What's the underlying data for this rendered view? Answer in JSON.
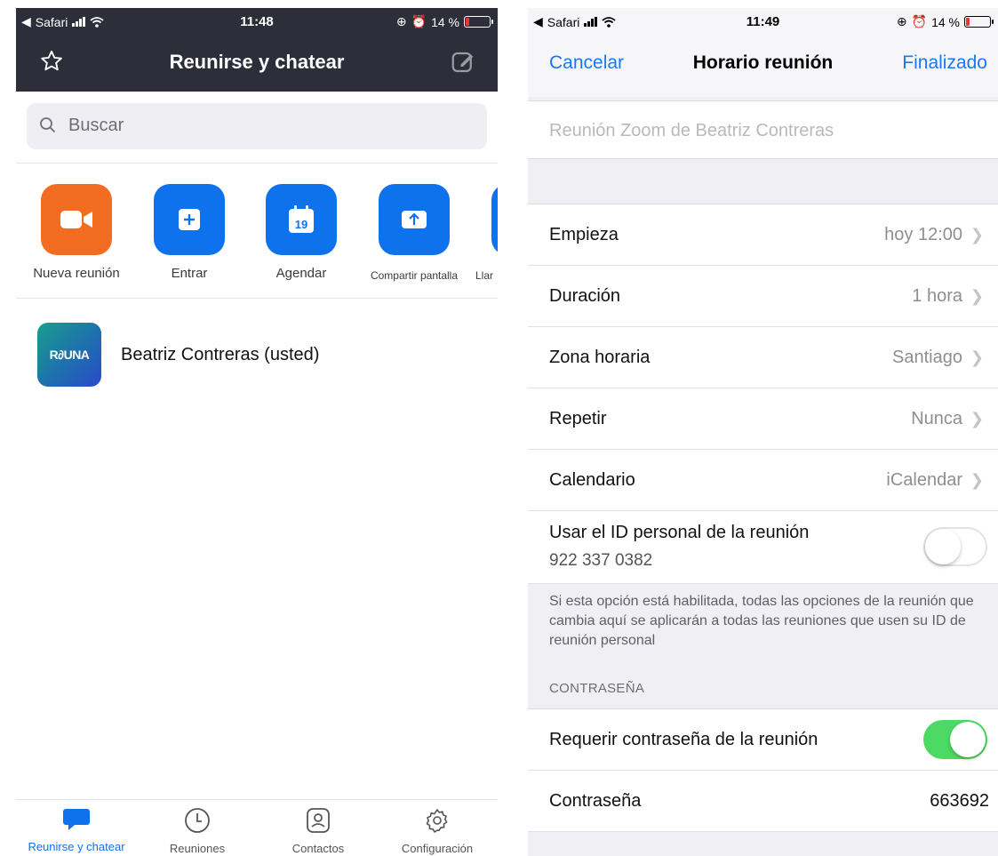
{
  "left": {
    "status": {
      "back_app": "Safari",
      "time": "11:48",
      "battery": "14 %"
    },
    "header": {
      "title": "Reunirse y chatear"
    },
    "search": {
      "placeholder": "Buscar"
    },
    "actions": [
      {
        "label": "Nueva reunión",
        "color": "#f26d21"
      },
      {
        "label": "Entrar",
        "color": "#0e72ed"
      },
      {
        "label": "Agendar",
        "color": "#0e72ed",
        "day": "19"
      },
      {
        "label": "Compartir pantalla",
        "color": "#0e72ed"
      },
      {
        "label": "Llar",
        "color": "#0e72ed"
      }
    ],
    "contact": {
      "avatar_text": "R∂UNA",
      "name": "Beatriz Contreras (usted)"
    },
    "tabs": [
      {
        "label": "Reunirse y chatear"
      },
      {
        "label": "Reuniones"
      },
      {
        "label": "Contactos"
      },
      {
        "label": "Configuración"
      }
    ],
    "accent": "#0e72ed"
  },
  "right": {
    "status": {
      "back_app": "Safari",
      "time": "11:49",
      "battery": "14 %"
    },
    "nav": {
      "cancel": "Cancelar",
      "title": "Horario reunión",
      "done": "Finalizado"
    },
    "topic_placeholder": "Reunión Zoom de Beatriz Contreras",
    "rows": [
      {
        "label": "Empieza",
        "value": "hoy 12:00"
      },
      {
        "label": "Duración",
        "value": "1 hora"
      },
      {
        "label": "Zona horaria",
        "value": "Santiago"
      },
      {
        "label": "Repetir",
        "value": "Nunca"
      },
      {
        "label": "Calendario",
        "value": "iCalendar"
      }
    ],
    "personal_id": {
      "label": "Usar el ID personal de la reunión",
      "id": "922 337 0382",
      "enabled": false
    },
    "note": "Si esta opción está habilitada, todas las opciones de la reunión que cambia aquí se aplicarán a todas las reuniones que usen su ID de reunión personal",
    "section_password": "CONTRASEÑA",
    "require_password": {
      "label": "Requerir contraseña de la reunión",
      "enabled": true
    },
    "password": {
      "label": "Contraseña",
      "value": "663692"
    },
    "toggle_on_color": "#4cd964",
    "link_color": "#1a78f5"
  }
}
